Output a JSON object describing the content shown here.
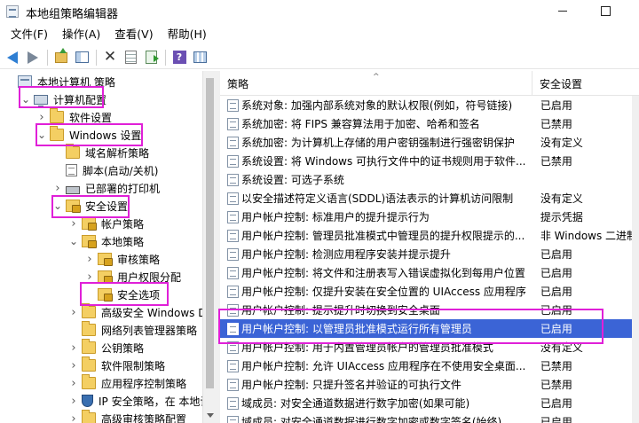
{
  "window": {
    "title": "本地组策略编辑器"
  },
  "menu": [
    "文件(F)",
    "操作(A)",
    "查看(V)",
    "帮助(H)"
  ],
  "toolbar": [
    {
      "icon": "back-arrow-icon"
    },
    {
      "icon": "forward-arrow-icon"
    },
    {
      "icon": "up-folder-icon"
    },
    {
      "icon": "show-hide-tree-icon"
    },
    {
      "icon": "delete-x-icon"
    },
    {
      "icon": "properties-icon"
    },
    {
      "icon": "export-list-icon"
    },
    {
      "icon": "help-icon"
    },
    {
      "icon": "view-icon"
    }
  ],
  "tree": [
    {
      "label": "本地计算机 策略",
      "icon": "policy-icon",
      "depth": 0,
      "expander": "none"
    },
    {
      "label": "计算机配置",
      "icon": "computer-icon",
      "depth": 1,
      "expander": "expanded"
    },
    {
      "label": "软件设置",
      "icon": "folder-icon",
      "depth": 2,
      "expander": "collapsed"
    },
    {
      "label": "Windows 设置",
      "icon": "folder-icon",
      "depth": 2,
      "expander": "expanded"
    },
    {
      "label": "域名解析策略",
      "icon": "folder-icon",
      "depth": 3,
      "expander": "none"
    },
    {
      "label": "脚本(启动/关机)",
      "icon": "script-doc-icon",
      "depth": 3,
      "expander": "none"
    },
    {
      "label": "已部署的打印机",
      "icon": "printer-icon",
      "depth": 3,
      "expander": "collapsed"
    },
    {
      "label": "安全设置",
      "icon": "security-folder-icon",
      "depth": 3,
      "expander": "expanded"
    },
    {
      "label": "帐户策略",
      "icon": "security-folder-icon",
      "depth": 4,
      "expander": "collapsed"
    },
    {
      "label": "本地策略",
      "icon": "security-folder-icon",
      "depth": 4,
      "expander": "expanded"
    },
    {
      "label": "审核策略",
      "icon": "security-folder-icon",
      "depth": 5,
      "expander": "collapsed"
    },
    {
      "label": "用户权限分配",
      "icon": "security-folder-icon",
      "depth": 5,
      "expander": "collapsed"
    },
    {
      "label": "安全选项",
      "icon": "security-folder-icon",
      "depth": 5,
      "expander": "none"
    },
    {
      "label": "高级安全 Windows De",
      "icon": "folder-icon",
      "depth": 4,
      "expander": "collapsed"
    },
    {
      "label": "网络列表管理器策略",
      "icon": "folder-icon",
      "depth": 4,
      "expander": "none"
    },
    {
      "label": "公钥策略",
      "icon": "folder-icon",
      "depth": 4,
      "expander": "collapsed"
    },
    {
      "label": "软件限制策略",
      "icon": "folder-icon",
      "depth": 4,
      "expander": "collapsed"
    },
    {
      "label": "应用程序控制策略",
      "icon": "folder-icon",
      "depth": 4,
      "expander": "collapsed"
    },
    {
      "label": "IP 安全策略，在 本地计",
      "icon": "shield-icon",
      "depth": 4,
      "expander": "collapsed"
    },
    {
      "label": "高级审核策略配置",
      "icon": "folder-icon",
      "depth": 4,
      "expander": "collapsed"
    }
  ],
  "list": {
    "columns": [
      "策略",
      "安全设置"
    ],
    "rows": [
      {
        "policy": "系统对象: 加强内部系统对象的默认权限(例如，符号链接)",
        "setting": "已启用",
        "selected": false
      },
      {
        "policy": "系统加密: 将 FIPS 兼容算法用于加密、哈希和签名",
        "setting": "已禁用",
        "selected": false
      },
      {
        "policy": "系统加密: 为计算机上存储的用户密钥强制进行强密钥保护",
        "setting": "没有定义",
        "selected": false
      },
      {
        "policy": "系统设置: 将 Windows 可执行文件中的证书规则用于软件...",
        "setting": "已禁用",
        "selected": false
      },
      {
        "policy": "系统设置: 可选子系统",
        "setting": "",
        "selected": false
      },
      {
        "policy": "以安全描述符定义语言(SDDL)语法表示的计算机访问限制",
        "setting": "没有定义",
        "selected": false
      },
      {
        "policy": "用户帐户控制: 标准用户的提升提示行为",
        "setting": "提示凭据",
        "selected": false
      },
      {
        "policy": "用户帐户控制: 管理员批准模式中管理员的提升权限提示的...",
        "setting": "非 Windows 二进制",
        "selected": false
      },
      {
        "policy": "用户帐户控制: 检测应用程序安装并提示提升",
        "setting": "已启用",
        "selected": false
      },
      {
        "policy": "用户帐户控制: 将文件和注册表写入错误虚拟化到每用户位置",
        "setting": "已启用",
        "selected": false
      },
      {
        "policy": "用户帐户控制: 仅提升安装在安全位置的 UIAccess 应用程序",
        "setting": "已启用",
        "selected": false
      },
      {
        "policy": "用户帐户控制: 提示提升时切换到安全桌面",
        "setting": "已启用",
        "selected": false
      },
      {
        "policy": "用户帐户控制: 以管理员批准模式运行所有管理员",
        "setting": "已启用",
        "selected": true
      },
      {
        "policy": "用户帐户控制: 用于内置管理员帐户的管理员批准模式",
        "setting": "没有定义",
        "selected": false
      },
      {
        "policy": "用户帐户控制: 允许 UIAccess 应用程序在不使用安全桌面...",
        "setting": "已禁用",
        "selected": false
      },
      {
        "policy": "用户帐户控制: 只提升签名并验证的可执行文件",
        "setting": "已禁用",
        "selected": false
      },
      {
        "policy": "域成员: 对安全通道数据进行数字加密(如果可能)",
        "setting": "已启用",
        "selected": false
      },
      {
        "policy": "域成员: 对安全通道数据进行数字加密或数字签名(始终)",
        "setting": "已启用",
        "selected": false
      }
    ]
  },
  "colors": {
    "selection": "#3b64d6",
    "highlight_annotation": "#e020d8"
  }
}
